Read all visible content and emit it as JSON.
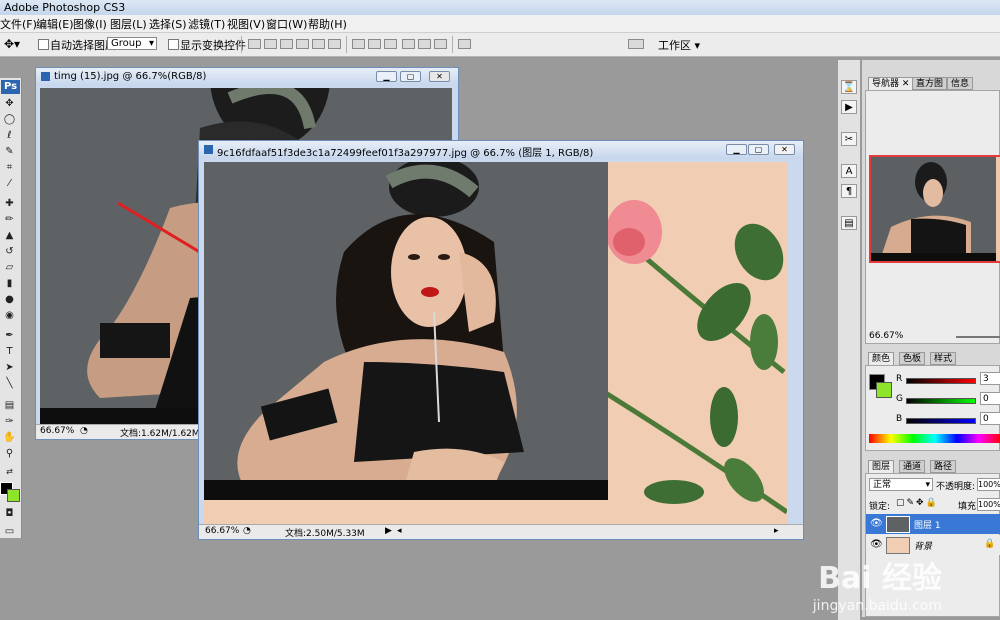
{
  "app": {
    "title": "Adobe Photoshop CS3"
  },
  "menu": [
    "文件(F)",
    "编辑(E)",
    "图像(I)",
    "图层(L)",
    "选择(S)",
    "滤镜(T)",
    "视图(V)",
    "窗口(W)",
    "帮助(H)"
  ],
  "options": {
    "auto_select_label": "自动选择图层",
    "group_value": "Group",
    "show_transform_label": "显示变换控件",
    "workspace_label": "工作区"
  },
  "toolbox": {
    "logo": "Ps"
  },
  "doc1": {
    "title": "timg (15).jpg @ 66.7%(RGB/8)",
    "zoom": "66.67%",
    "doc_size": "文档:1.62M/1.62M"
  },
  "doc2": {
    "title": "9c16fdfaaf51f3de3c1a72499feef01f3a297977.jpg @ 66.7% (图层 1, RGB/8)",
    "zoom": "66.67%",
    "doc_size": "文档:2.50M/5.33M"
  },
  "navigator": {
    "tabs": [
      "导航器",
      "直方图",
      "信息"
    ],
    "zoom": "66.67%"
  },
  "color": {
    "tabs": [
      "颜色",
      "色板",
      "样式"
    ],
    "r_label": "R",
    "g_label": "G",
    "b_label": "B",
    "r": "3",
    "g": "0",
    "b": "0",
    "foreground": "#030000",
    "background": "#8ee428"
  },
  "layers": {
    "tabs": [
      "图层",
      "通道",
      "路径"
    ],
    "blend_mode": "正常",
    "opacity_label": "不透明度:",
    "opacity": "100%",
    "lock_label": "锁定:",
    "fill_label": "填充:",
    "fill": "100%",
    "items": [
      {
        "name": "图层 1",
        "selected": true
      },
      {
        "name": "背景",
        "selected": false
      }
    ]
  },
  "watermark": {
    "brand": "Bai 经验",
    "url": "jingyan.baidu.com"
  }
}
